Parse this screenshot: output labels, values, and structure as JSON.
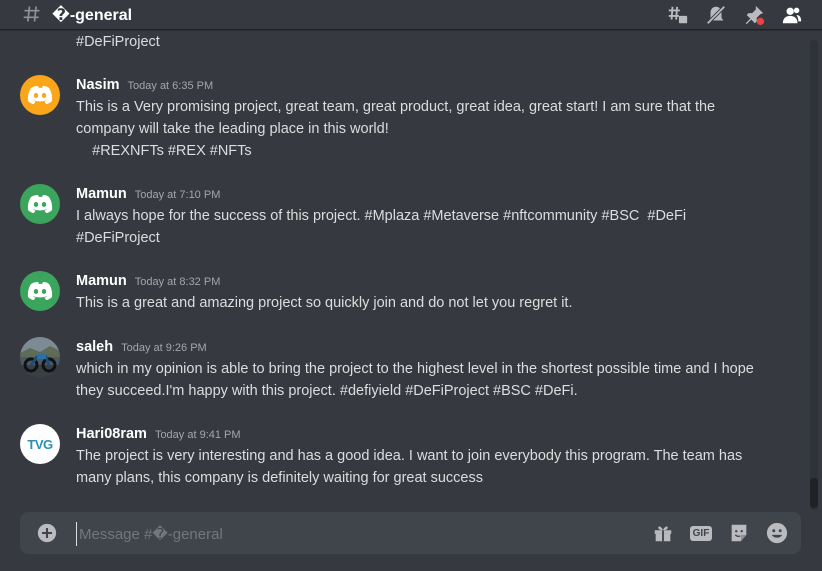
{
  "header": {
    "channel_name": "�-general",
    "icons": [
      "threads-icon",
      "notification-muted-icon",
      "pin-icon",
      "members-icon"
    ]
  },
  "messages": [
    {
      "type": "continuation",
      "text": "#DeFiProject"
    },
    {
      "username": "Nasim",
      "timestamp": "Today at 6:35 PM",
      "avatar": "discord-default-avatar",
      "avatar_color": "#faa61a",
      "text": "This is a Very promising project, great team, great product, great idea, great start! I am sure that the company will take the leading place in this world!\n    #REXNFTs #REX #NFTs"
    },
    {
      "username": "Mamun",
      "timestamp": "Today at 7:10 PM",
      "avatar": "discord-default-avatar",
      "avatar_color": "#3ba55d",
      "text": "I always hope for the success of this project. #Mplaza #Metaverse #nftcommunity #BSC  #DeFi\n#DeFiProject"
    },
    {
      "username": "Mamun",
      "timestamp": "Today at 8:32 PM",
      "avatar": "discord-default-avatar",
      "avatar_color": "#3ba55d",
      "text": "This is a great and amazing project so quickly join and do not let you regret it."
    },
    {
      "username": "saleh",
      "timestamp": "Today at 9:26 PM",
      "avatar": "motorcycle-photo-avatar",
      "text": "which in my opinion is able to bring the project to the highest level in the shortest possible time and I hope they succeed.I'm happy with this project. #defiyield #DeFiProject #BSC #DeFi."
    },
    {
      "username": "Hari08ram",
      "timestamp": "Today at 9:41 PM",
      "avatar": "tvg-logo-avatar",
      "avatar_logo": "TVG",
      "text": "The project is very interesting and has a good idea. I want to join everybody this program. The team has many plans, this company is definitely waiting for great success"
    }
  ],
  "composer": {
    "placeholder": "Message #�-general",
    "value": "",
    "gif_label": "GIF"
  },
  "colors": {
    "background": "#36393f",
    "composer_bg": "#40444b",
    "text": "#dcddde",
    "muted": "#a3a6aa",
    "mute_slash": "#ed4245"
  }
}
